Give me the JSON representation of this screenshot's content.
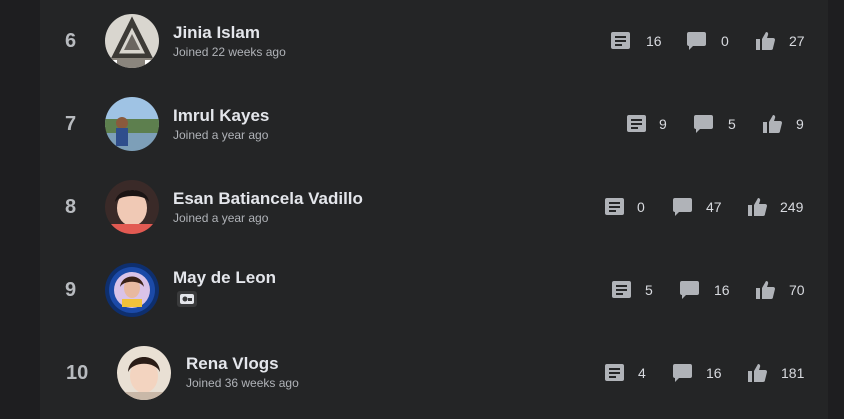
{
  "leaderboard": {
    "rows": [
      {
        "rank": "6",
        "name": "Jinia Islam",
        "joined": "Joined 22 weeks ago",
        "posts": "16",
        "comments": "0",
        "reactions": "27"
      },
      {
        "rank": "7",
        "name": "Imrul Kayes",
        "joined": "Joined a year ago",
        "posts": "9",
        "comments": "5",
        "reactions": "9"
      },
      {
        "rank": "8",
        "name": "Esan Batiancela Vadillo",
        "joined": "Joined a year ago",
        "posts": "0",
        "comments": "47",
        "reactions": "249"
      },
      {
        "rank": "9",
        "name": "May de Leon",
        "joined": "",
        "badge_icon": "profile-badge-icon",
        "posts": "5",
        "comments": "16",
        "reactions": "70"
      },
      {
        "rank": "10",
        "name": "Rena Vlogs",
        "joined": "Joined 36 weeks ago",
        "posts": "4",
        "comments": "16",
        "reactions": "181"
      }
    ]
  },
  "icons": {
    "posts": "post-icon",
    "comments": "comment-icon",
    "reactions": "thumbs-up-icon"
  },
  "colors": {
    "page_background": "#1e1e20",
    "panel_background": "#242526",
    "name_text": "#e4e6eb",
    "meta_text": "#b0b3b8",
    "icon": "#b0b3b8"
  }
}
